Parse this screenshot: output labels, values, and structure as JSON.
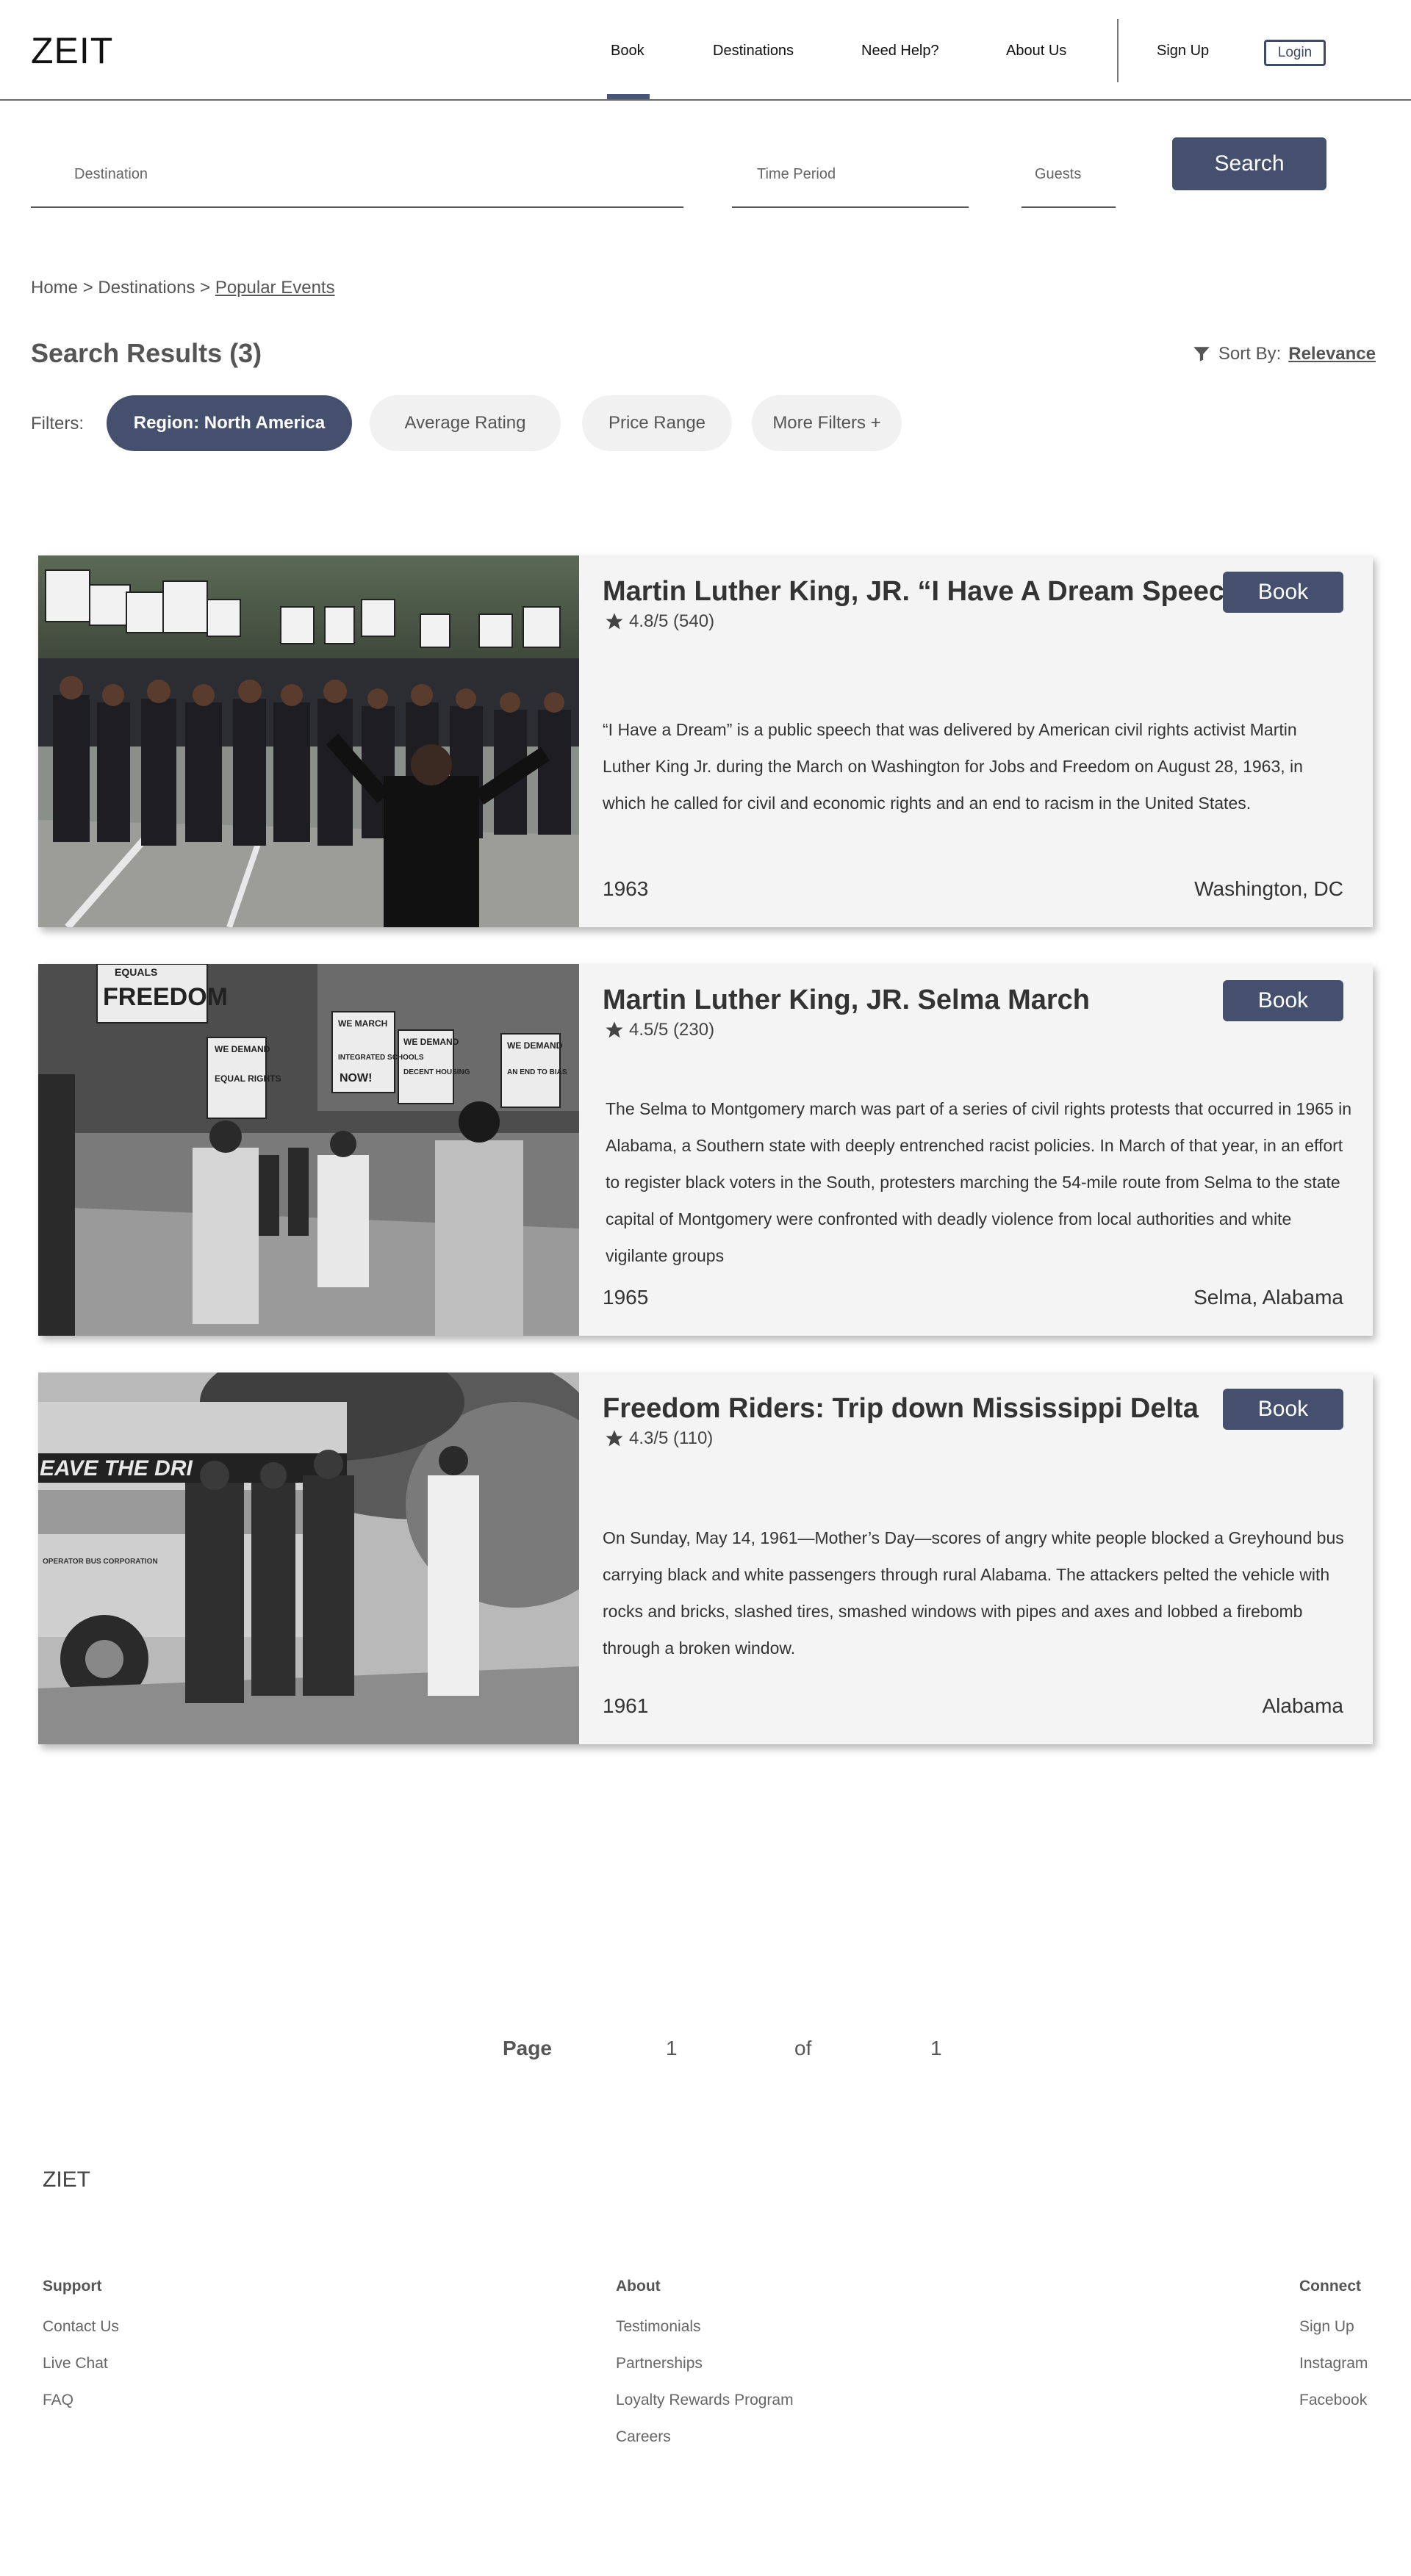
{
  "header": {
    "logo": "ZEIT",
    "nav": [
      {
        "label": "Book"
      },
      {
        "label": "Destinations"
      },
      {
        "label": "Need Help?"
      },
      {
        "label": "About Us"
      }
    ],
    "signup_label": "Sign Up",
    "login_label": "Login"
  },
  "search": {
    "destination_label": "Destination",
    "time_label": "Time Period",
    "guests_label": "Guests",
    "button_label": "Search"
  },
  "breadcrumb": {
    "home": "Home",
    "sep": ">",
    "destinations": "Destinations",
    "current": "Popular Events"
  },
  "results": {
    "title": "Search Results (3)",
    "sort_prefix": "Sort By:",
    "sort_value": "Relevance",
    "filters_label": "Filters:",
    "filters": [
      {
        "label": "Region: North America",
        "active": true
      },
      {
        "label": "Average Rating",
        "active": false
      },
      {
        "label": "Price Range",
        "active": false
      },
      {
        "label": "More Filters +",
        "active": false
      }
    ]
  },
  "cards": [
    {
      "title": "Martin Luther King, JR. “I Have A Dream Speech”",
      "rating": "4.8/5 (540)",
      "description": "“I Have a Dream” is a public speech that was delivered by American civil rights activist Martin Luther King Jr. during the March on Washington for Jobs and Freedom on August 28, 1963, in which he called for civil and economic rights and an end to racism in the United States.",
      "year": "1963",
      "location": "Washington, DC",
      "book_label": "Book",
      "image": "march-on-washington-photo"
    },
    {
      "title": "Martin Luther King, JR. Selma March",
      "rating": "4.5/5 (230)",
      "description": "The Selma to Montgomery march was part of a series of civil rights protests that occurred in 1965 in Alabama, a Southern state with deeply entrenched racist policies. In March of that year, in an effort to register black voters in the South, protesters marching the 54-mile route from Selma to the state capital of Montgomery were confronted with deadly violence from local authorities and white vigilante groups",
      "year": "1965",
      "location": "Selma, Alabama",
      "book_label": "Book",
      "image": "selma-march-photo",
      "sign_texts": [
        "EQUALS",
        "FREEDOM",
        "WE DEMAND",
        "WE MARCH",
        "WE DEMAND",
        "WE DEMAND",
        "EQUAL RIGHTS",
        "INTEGRATED SCHOOLS",
        "DECENT HOUSING",
        "AN END TO BIAS",
        "NOW!"
      ]
    },
    {
      "title": "Freedom Riders: Trip down Mississippi Delta",
      "rating": "4.3/5 (110)",
      "description": "On Sunday, May 14, 1961—Mother’s Day—scores of angry white people blocked a Greyhound bus carrying black and white passengers through rural Alabama. The attackers pelted the vehicle with rocks and bricks, slashed tires, smashed windows with pipes and axes and lobbed a firebomb through a broken window.",
      "year": "1961",
      "location": "Alabama",
      "book_label": "Book",
      "image": "freedom-riders-bus-photo",
      "bus_text": "EAVE THE DRI",
      "bus_small": "OPERATOR BUS CORPORATION"
    }
  ],
  "pagination": {
    "page_label": "Page",
    "current": "1",
    "of_label": "of",
    "total": "1"
  },
  "footer": {
    "logo": "ZIET",
    "support": {
      "title": "Support",
      "links": [
        "Contact Us",
        "Live Chat",
        "FAQ"
      ]
    },
    "about": {
      "title": "About",
      "links": [
        "Testimonials",
        "Partnerships",
        "Loyalty Rewards Program",
        "Careers"
      ]
    },
    "connect": {
      "title": "Connect",
      "links": [
        "Sign Up",
        "Instagram",
        "Facebook"
      ]
    }
  },
  "colors": {
    "accent": "#44506e",
    "chip_bg": "#f1f1f1",
    "card_bg": "#f4f4f4"
  }
}
